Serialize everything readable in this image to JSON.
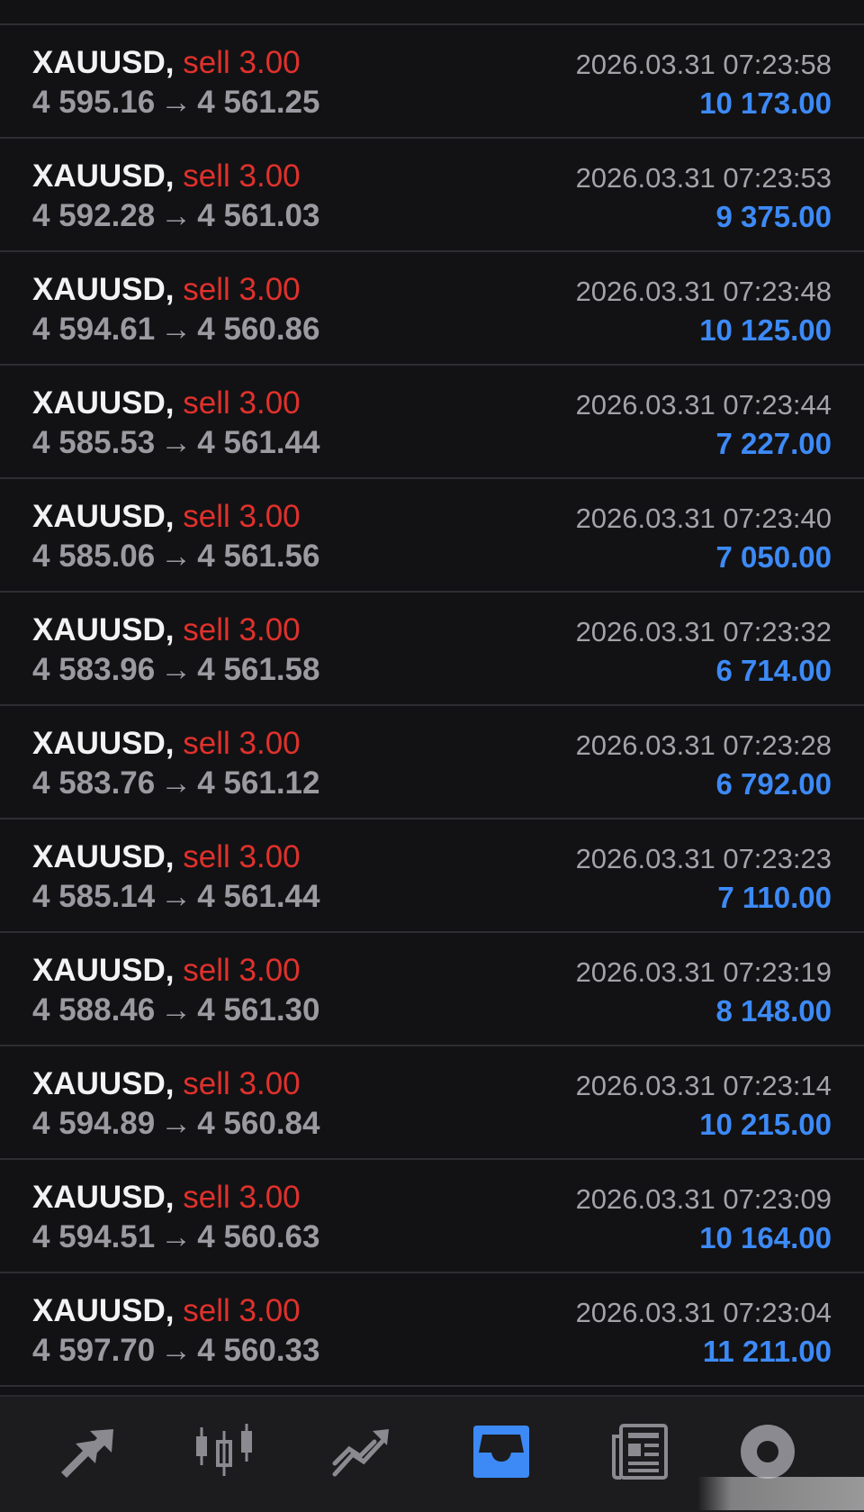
{
  "trades": [
    {
      "symbol": "XAUUSD,",
      "side": "sell",
      "volume": "3.00",
      "open_price": "4 595.16",
      "close_price": "4 561.25",
      "time": "2026.03.31 07:23:58",
      "profit": "10 173.00"
    },
    {
      "symbol": "XAUUSD,",
      "side": "sell",
      "volume": "3.00",
      "open_price": "4 592.28",
      "close_price": "4 561.03",
      "time": "2026.03.31 07:23:53",
      "profit": "9 375.00"
    },
    {
      "symbol": "XAUUSD,",
      "side": "sell",
      "volume": "3.00",
      "open_price": "4 594.61",
      "close_price": "4 560.86",
      "time": "2026.03.31 07:23:48",
      "profit": "10 125.00"
    },
    {
      "symbol": "XAUUSD,",
      "side": "sell",
      "volume": "3.00",
      "open_price": "4 585.53",
      "close_price": "4 561.44",
      "time": "2026.03.31 07:23:44",
      "profit": "7 227.00"
    },
    {
      "symbol": "XAUUSD,",
      "side": "sell",
      "volume": "3.00",
      "open_price": "4 585.06",
      "close_price": "4 561.56",
      "time": "2026.03.31 07:23:40",
      "profit": "7 050.00"
    },
    {
      "symbol": "XAUUSD,",
      "side": "sell",
      "volume": "3.00",
      "open_price": "4 583.96",
      "close_price": "4 561.58",
      "time": "2026.03.31 07:23:32",
      "profit": "6 714.00"
    },
    {
      "symbol": "XAUUSD,",
      "side": "sell",
      "volume": "3.00",
      "open_price": "4 583.76",
      "close_price": "4 561.12",
      "time": "2026.03.31 07:23:28",
      "profit": "6 792.00"
    },
    {
      "symbol": "XAUUSD,",
      "side": "sell",
      "volume": "3.00",
      "open_price": "4 585.14",
      "close_price": "4 561.44",
      "time": "2026.03.31 07:23:23",
      "profit": "7 110.00"
    },
    {
      "symbol": "XAUUSD,",
      "side": "sell",
      "volume": "3.00",
      "open_price": "4 588.46",
      "close_price": "4 561.30",
      "time": "2026.03.31 07:23:19",
      "profit": "8 148.00"
    },
    {
      "symbol": "XAUUSD,",
      "side": "sell",
      "volume": "3.00",
      "open_price": "4 594.89",
      "close_price": "4 560.84",
      "time": "2026.03.31 07:23:14",
      "profit": "10 215.00"
    },
    {
      "symbol": "XAUUSD,",
      "side": "sell",
      "volume": "3.00",
      "open_price": "4 594.51",
      "close_price": "4 560.63",
      "time": "2026.03.31 07:23:09",
      "profit": "10 164.00"
    },
    {
      "symbol": "XAUUSD,",
      "side": "sell",
      "volume": "3.00",
      "open_price": "4 597.70",
      "close_price": "4 560.33",
      "time": "2026.03.31 07:23:04",
      "profit": "11 211.00"
    }
  ],
  "arrow_glyph": "→",
  "nav": {
    "items": [
      {
        "icon": "quotes-arrows-icon",
        "active": false
      },
      {
        "icon": "candlestick-chart-icon",
        "active": false
      },
      {
        "icon": "trend-line-icon",
        "active": false
      },
      {
        "icon": "history-inbox-icon",
        "active": true
      },
      {
        "icon": "news-icon",
        "active": false
      },
      {
        "icon": "settings-icon",
        "active": false
      }
    ]
  },
  "colors": {
    "background": "#121214",
    "symbol": "#f2f2f2",
    "sell": "#e0312c",
    "price": "#9a9aa0",
    "time": "#a3a3a8",
    "profit": "#3d8af7",
    "nav_inactive": "#8a8a90",
    "nav_active": "#3d8af7"
  }
}
